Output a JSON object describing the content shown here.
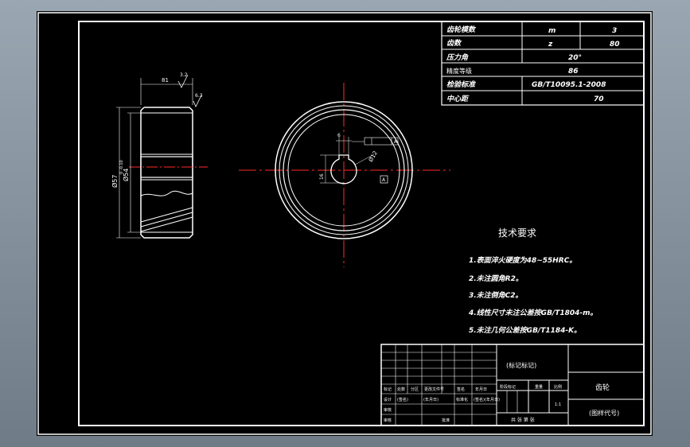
{
  "title_block": {
    "mark_label": "(标记标记)",
    "part_name": "齿轮",
    "drawing_no": "(图样代号)",
    "scale": "1:1",
    "mid_headers": [
      "阶段标记",
      "重量",
      "比例"
    ],
    "rev_row": [
      "标记",
      "处数",
      "分区",
      "更改文件号",
      "签名",
      "年月日"
    ],
    "design_row": [
      "设计",
      "(签名)",
      "(年月日)",
      "标准化",
      "(签名)",
      "(年月日)"
    ],
    "left_labels": [
      "审核",
      "审核",
      "工艺"
    ],
    "approve_label": "批准",
    "sheet_labels": "共  张  第  张"
  },
  "gear_params": {
    "rows": [
      {
        "label": "齿轮模数",
        "sym": "m",
        "val": "3"
      },
      {
        "label": "齿数",
        "sym": "z",
        "val": "80"
      },
      {
        "label": "压力角",
        "sym": "",
        "val": "20°"
      },
      {
        "label": "精度等级",
        "sym": "",
        "val": "86"
      },
      {
        "label": "检验标准",
        "sym": "",
        "val": "GB/T10095.1-2008"
      },
      {
        "label": "中心距",
        "sym": "",
        "val": "70"
      }
    ]
  },
  "tech_req": {
    "title": "技术要求",
    "items": [
      "1.表面淬火硬度为48~55HRC。",
      "2.未注圆角R2。",
      "3.未注倒角C2。",
      "4.线性尺寸未注公差按GB/T1804-m。",
      "5.未注几何公差按GB/T1184-K。"
    ]
  },
  "dims": {
    "width": "81",
    "od": "Ø57",
    "od_tol": "0\n-0.10",
    "bore_major": "Ø54",
    "keyway_h": "16",
    "keyway_b": "6",
    "bore": "Ø12",
    "roughness": "3.2",
    "roughness2": "6.3",
    "datum": "A"
  }
}
